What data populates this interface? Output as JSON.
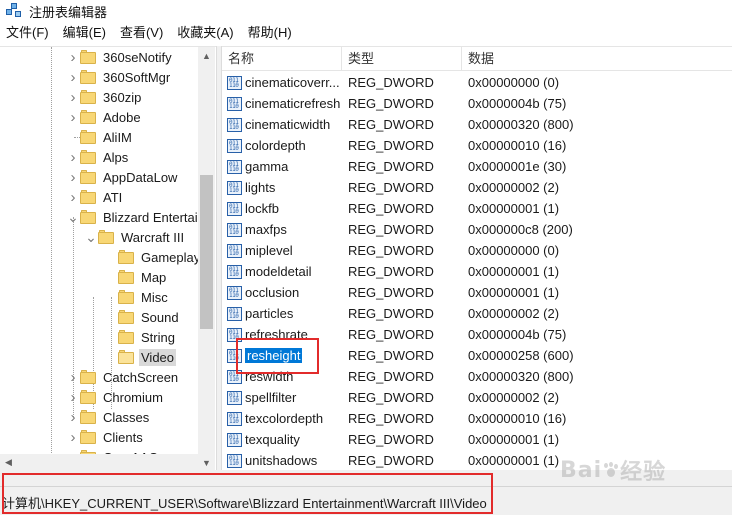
{
  "window": {
    "title": "注册表编辑器",
    "icon": "registry-editor-icon"
  },
  "menu": [
    "文件(F)",
    "编辑(E)",
    "查看(V)",
    "收藏夹(A)",
    "帮助(H)"
  ],
  "tree": {
    "items": [
      {
        "label": "360seNotify",
        "expander": "collapsed",
        "level": 0
      },
      {
        "label": "360SoftMgr",
        "expander": "collapsed",
        "level": 0
      },
      {
        "label": "360zip",
        "expander": "collapsed",
        "level": 0
      },
      {
        "label": "Adobe",
        "expander": "collapsed",
        "level": 0
      },
      {
        "label": "AliIM",
        "expander": "none",
        "level": 0
      },
      {
        "label": "Alps",
        "expander": "collapsed",
        "level": 0
      },
      {
        "label": "AppDataLow",
        "expander": "collapsed",
        "level": 0
      },
      {
        "label": "ATI",
        "expander": "collapsed",
        "level": 0
      },
      {
        "label": "Blizzard Entertai",
        "expander": "expanded",
        "level": 0
      },
      {
        "label": "Warcraft III",
        "expander": "expanded",
        "level": 1
      },
      {
        "label": "Gameplay",
        "expander": "none",
        "level": 2
      },
      {
        "label": "Map",
        "expander": "none",
        "level": 2
      },
      {
        "label": "Misc",
        "expander": "none",
        "level": 2
      },
      {
        "label": "Sound",
        "expander": "none",
        "level": 2
      },
      {
        "label": "String",
        "expander": "none",
        "level": 2
      },
      {
        "label": "Video",
        "expander": "none",
        "level": 2,
        "selected": true
      },
      {
        "label": "CatchScreen",
        "expander": "collapsed",
        "level": 0
      },
      {
        "label": "Chromium",
        "expander": "collapsed",
        "level": 0
      },
      {
        "label": "Classes",
        "expander": "collapsed",
        "level": 0
      },
      {
        "label": "Clients",
        "expander": "collapsed",
        "level": 0
      },
      {
        "label": "CoreAAC",
        "expander": "collapsed",
        "level": 0
      }
    ]
  },
  "list": {
    "headers": {
      "name": "名称",
      "type": "类型",
      "data": "数据"
    },
    "rows": [
      {
        "name": "cinematicoverr...",
        "type": "REG_DWORD",
        "data": "0x00000000 (0)"
      },
      {
        "name": "cinematicrefresh",
        "type": "REG_DWORD",
        "data": "0x0000004b (75)"
      },
      {
        "name": "cinematicwidth",
        "type": "REG_DWORD",
        "data": "0x00000320 (800)"
      },
      {
        "name": "colordepth",
        "type": "REG_DWORD",
        "data": "0x00000010 (16)"
      },
      {
        "name": "gamma",
        "type": "REG_DWORD",
        "data": "0x0000001e (30)"
      },
      {
        "name": "lights",
        "type": "REG_DWORD",
        "data": "0x00000002 (2)"
      },
      {
        "name": "lockfb",
        "type": "REG_DWORD",
        "data": "0x00000001 (1)"
      },
      {
        "name": "maxfps",
        "type": "REG_DWORD",
        "data": "0x000000c8 (200)"
      },
      {
        "name": "miplevel",
        "type": "REG_DWORD",
        "data": "0x00000000 (0)"
      },
      {
        "name": "modeldetail",
        "type": "REG_DWORD",
        "data": "0x00000001 (1)"
      },
      {
        "name": "occlusion",
        "type": "REG_DWORD",
        "data": "0x00000001 (1)"
      },
      {
        "name": "particles",
        "type": "REG_DWORD",
        "data": "0x00000002 (2)"
      },
      {
        "name": "refreshrate",
        "type": "REG_DWORD",
        "data": "0x0000004b (75)"
      },
      {
        "name": "resheight",
        "type": "REG_DWORD",
        "data": "0x00000258 (600)",
        "selected": true
      },
      {
        "name": "reswidth",
        "type": "REG_DWORD",
        "data": "0x00000320 (800)"
      },
      {
        "name": "spellfilter",
        "type": "REG_DWORD",
        "data": "0x00000002 (2)"
      },
      {
        "name": "texcolordepth",
        "type": "REG_DWORD",
        "data": "0x00000010 (16)"
      },
      {
        "name": "texquality",
        "type": "REG_DWORD",
        "data": "0x00000001 (1)"
      },
      {
        "name": "unitshadows",
        "type": "REG_DWORD",
        "data": "0x00000001 (1)"
      }
    ],
    "value_icon": "reg-dword-icon"
  },
  "status": {
    "path": "计算机\\HKEY_CURRENT_USER\\Software\\Blizzard Entertainment\\Warcraft III\\Video"
  },
  "colors": {
    "selection": "#0078d7",
    "annotation": "#e22b2b",
    "folder": "#f8d775"
  },
  "watermark": {
    "text_a": "Bai",
    "text_b": "经验"
  }
}
